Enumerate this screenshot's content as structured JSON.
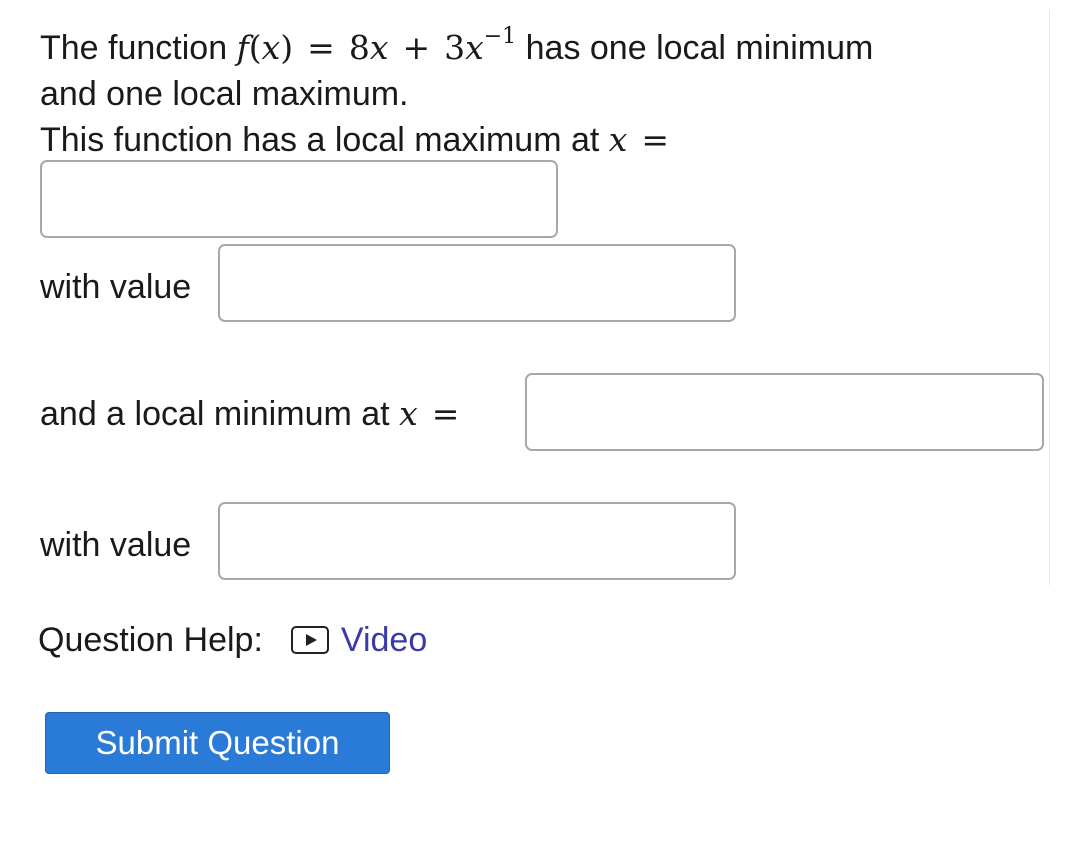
{
  "question": {
    "intro_text": "The function",
    "func_name": "f",
    "func_var": "x",
    "equals": "=",
    "rhs_coef1": "8",
    "rhs_var1": "x",
    "rhs_plus": "+",
    "rhs_coef2": "3",
    "rhs_var2": "x",
    "rhs_exponent": "−1",
    "after_math": "has one local minimum",
    "line2": "and one local maximum.",
    "line3_text": "This function has a local maximum at",
    "line3_var": "x",
    "line3_eq": "="
  },
  "fields": {
    "max_x_value": "",
    "max_value_label": "with value",
    "max_value": "",
    "min_label_text": "and a local minimum at",
    "min_label_var": "x",
    "min_label_eq": "=",
    "min_x_value": "",
    "min_value_label": "with value",
    "min_value": ""
  },
  "help": {
    "label": "Question Help:",
    "icon": "video-play-icon",
    "video_label": "Video"
  },
  "actions": {
    "submit_label": "Submit Question"
  },
  "colors": {
    "submit_bg": "#2a7ad8",
    "link": "#3a3aa8",
    "input_border": "#a8a8a8"
  }
}
